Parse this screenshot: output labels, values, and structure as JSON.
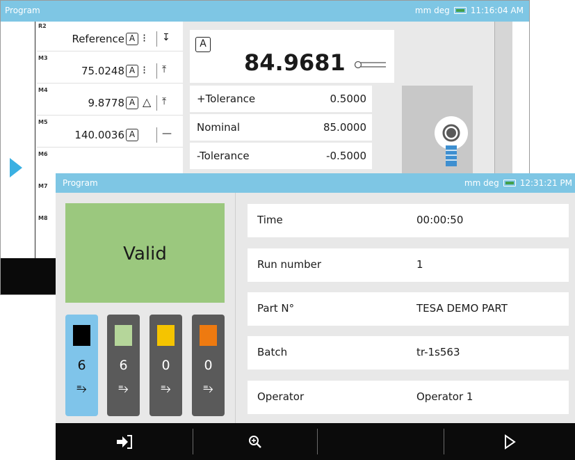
{
  "back_window": {
    "title": "Program",
    "status": {
      "units": "mm deg",
      "time": "11:16:04 AM"
    },
    "measurements": [
      {
        "tag": "R2",
        "value": "Reference",
        "box": "A",
        "sym": "⁝",
        "tol": "↧"
      },
      {
        "tag": "M3",
        "value": "75.0248",
        "box": "A",
        "sym": "⁝",
        "tol": "⤒"
      },
      {
        "tag": "M4",
        "value": "9.8778",
        "box": "A",
        "sym": "△",
        "tol": "⤒"
      },
      {
        "tag": "M5",
        "value": "140.0036",
        "box": "A",
        "sym": "",
        "tol": "—"
      },
      {
        "tag": "M6",
        "value": "",
        "box": "",
        "sym": "",
        "tol": ""
      },
      {
        "tag": "M7",
        "value": "",
        "box": "",
        "sym": "",
        "tol": ""
      },
      {
        "tag": "M8",
        "value": "",
        "box": "",
        "sym": "",
        "tol": ""
      }
    ],
    "big_box": "A",
    "big_value": "84.9681",
    "tolerances": [
      {
        "label": "+Tolerance",
        "value": "0.5000"
      },
      {
        "label": "Nominal",
        "value": "85.0000"
      },
      {
        "label": "-Tolerance",
        "value": "-0.5000"
      }
    ]
  },
  "front_window": {
    "title": "Program",
    "status": {
      "units": "mm deg",
      "time": "12:31:21 PM"
    },
    "result": "Valid",
    "counters": [
      {
        "color": "#000000",
        "count": "6",
        "selected": true
      },
      {
        "color": "#b5d69a",
        "count": "6",
        "selected": false
      },
      {
        "color": "#f5c400",
        "count": "0",
        "selected": false
      },
      {
        "color": "#ee7a10",
        "count": "0",
        "selected": false
      }
    ],
    "info": [
      {
        "label": "Time",
        "value": "00:00:50"
      },
      {
        "label": "Run number",
        "value": "1"
      },
      {
        "label": "Part N°",
        "value": "TESA DEMO PART"
      },
      {
        "label": "Batch",
        "value": "tr-1s563"
      },
      {
        "label": "Operator",
        "value": "Operator 1"
      }
    ],
    "toolbar": {
      "exit_icon": "exit-icon",
      "zoom_icon": "zoom-in-icon",
      "next_icon": "play-outline-icon"
    }
  },
  "colors": {
    "titlebar": "#7ec6e4",
    "valid": "#9bc87e",
    "selected_counter": "#7fc4ea",
    "counter": "#5a5a5a",
    "accent_arrow": "#3ab0e2"
  }
}
